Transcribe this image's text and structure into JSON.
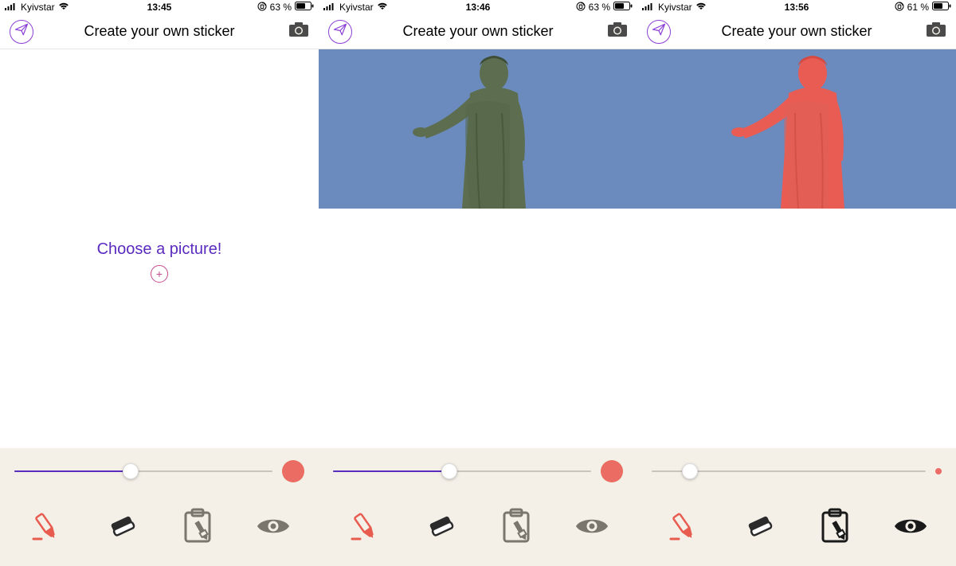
{
  "panes": [
    {
      "status": {
        "carrier": "Kyivstar",
        "time": "13:45",
        "battery": "63 %"
      },
      "nav": {
        "title": "Create your own sticker"
      },
      "choose": {
        "label": "Choose a picture!"
      },
      "slider": {
        "fill_pct": 45,
        "thumb_pct": 45,
        "dot_size": "large"
      },
      "tools_active": {
        "marker": false,
        "eye": false
      }
    },
    {
      "status": {
        "carrier": "Kyivstar",
        "time": "13:46",
        "battery": "63 %"
      },
      "nav": {
        "title": "Create your own sticker"
      },
      "image": {
        "overlay": false
      },
      "slider": {
        "fill_pct": 45,
        "thumb_pct": 45,
        "dot_size": "large"
      },
      "tools_active": {
        "marker": false,
        "eye": false
      }
    },
    {
      "status": {
        "carrier": "Kyivstar",
        "time": "13:56",
        "battery": "61 %"
      },
      "nav": {
        "title": "Create your own sticker"
      },
      "image": {
        "overlay": true
      },
      "slider": {
        "fill_pct": 0,
        "thumb_pct": 14,
        "dot_size": "small"
      },
      "tools_active": {
        "marker": true,
        "eye": true
      }
    }
  ],
  "icons": {
    "send": "send-icon",
    "camera": "camera-icon",
    "signal": "signal-icon",
    "wifi": "wifi-icon",
    "orientation": "orientation-lock-icon",
    "battery": "battery-icon",
    "plus": "plus-icon",
    "marker": "marker-icon",
    "eraser": "eraser-icon",
    "clipboard": "clipboard-brush-icon",
    "eye": "eye-icon"
  },
  "colors": {
    "accent_purple": "#5A2BBF",
    "accent_red": "#EB6C63",
    "toolbar_bg": "#F4F0E8",
    "sky": "#6B8BBE",
    "statue": "#5C6E4F",
    "overlay": "#E85C54"
  }
}
